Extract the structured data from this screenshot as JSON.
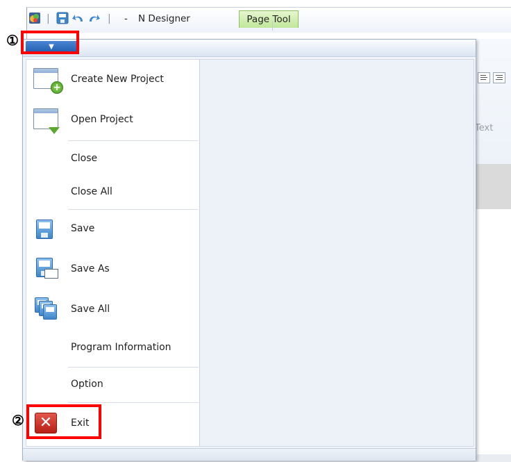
{
  "titlebar": {
    "app_title": "N Designer",
    "dash": "-",
    "context_tab": "Page Tool",
    "separator": "|"
  },
  "background": {
    "ribbon_text": "Text"
  },
  "menu": {
    "items": [
      {
        "label": "Create New Project",
        "icon": "new-project-icon"
      },
      {
        "label": "Open Project",
        "icon": "open-project-icon"
      },
      {
        "label": "Close"
      },
      {
        "label": "Close All"
      },
      {
        "label": "Save",
        "icon": "save-icon"
      },
      {
        "label": "Save As",
        "icon": "save-as-icon"
      },
      {
        "label": "Save All",
        "icon": "save-all-icon"
      },
      {
        "label": "Program Information"
      },
      {
        "label": "Option"
      },
      {
        "label": "Exit",
        "icon": "exit-icon"
      }
    ]
  },
  "annotations": {
    "badge1": "①",
    "badge2": "②",
    "color": "#ff0000"
  }
}
